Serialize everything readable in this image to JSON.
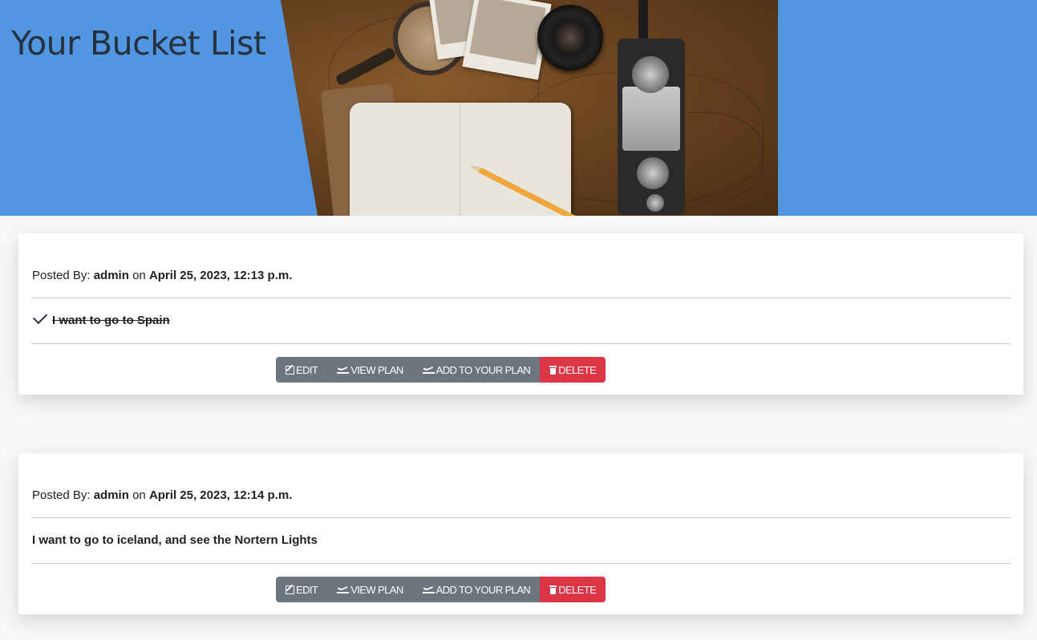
{
  "header": {
    "title": "Your Bucket List",
    "hero_image": "travel-desk-photo"
  },
  "labels": {
    "posted_by": "Posted By:",
    "on": "on"
  },
  "posts": [
    {
      "author": "admin",
      "date": "April 25, 2023, 12:13 p.m.",
      "text": "I want to go to Spain",
      "completed": true,
      "buttons": {
        "edit": "EDIT",
        "view_plan": "VIEW PLAN",
        "add_plan": "ADD TO YOUR PLAN",
        "delete": "DELETE"
      }
    },
    {
      "author": "admin",
      "date": "April 25, 2023, 12:14 p.m.",
      "text": "I want to go to iceland, and see the Nortern Lights",
      "completed": false,
      "buttons": {
        "edit": "EDIT",
        "view_plan": "VIEW PLAN",
        "add_plan": "ADD TO YOUR PLAN",
        "delete": "DELETE"
      }
    }
  ],
  "colors": {
    "header_bg": "#5295e0",
    "title": "#263140",
    "secondary": "#6c757d",
    "danger": "#dc3545"
  },
  "icons": {
    "edit": "pencil-square-icon",
    "view_plan": "plane-departure-icon",
    "add_plan": "plane-departure-icon",
    "delete": "trash-icon",
    "done": "check-icon"
  }
}
